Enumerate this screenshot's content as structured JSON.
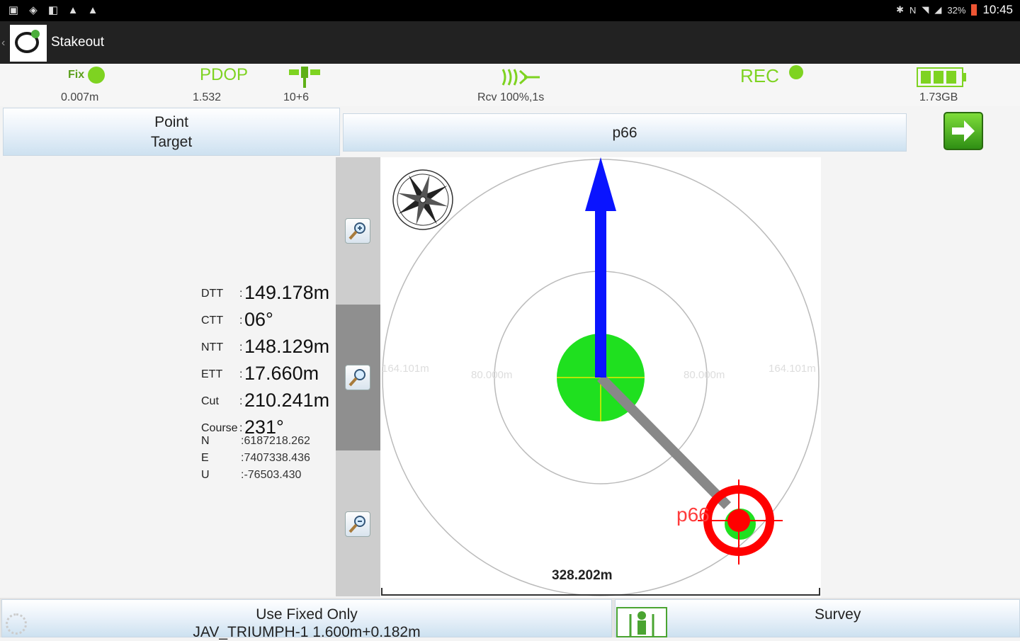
{
  "status_bar": {
    "left_icons": [
      "gallery-icon",
      "shield-icon",
      "mute-icon",
      "warning-icon",
      "warning-icon"
    ],
    "right_icons": [
      "bluetooth-icon",
      "nfc-icon",
      "wifi-icon",
      "signal-icon",
      "battery-icon"
    ],
    "battery_text": "32%",
    "time": "10:45"
  },
  "action_bar": {
    "title": "Stakeout"
  },
  "info_bar": {
    "fix_label": "Fix",
    "fix_value": "0.007m",
    "pdop_label": "PDOP",
    "pdop_value": "1.532",
    "sats_value": "10+6",
    "rcv_value": "Rcv 100%,1s",
    "rec_label": "REC",
    "storage_value": "1.73GB",
    "accent_color": "#7ed321"
  },
  "target": {
    "line1": "Point",
    "line2": "Target",
    "point_name": "p66"
  },
  "readouts": [
    {
      "label": "DTT",
      "value": "149.178m",
      "size": "big"
    },
    {
      "label": "CTT",
      "value": "06°",
      "size": "big"
    },
    {
      "label": "NTT",
      "value": "148.129m",
      "size": "big"
    },
    {
      "label": "ETT",
      "value": "17.660m",
      "size": "big"
    },
    {
      "label": "Cut",
      "value": "210.241m",
      "size": "big"
    },
    {
      "label": "Course",
      "value": "231°",
      "size": "big"
    },
    {
      "label": "N",
      "value": "6187218.262",
      "size": "small"
    },
    {
      "label": "E",
      "value": "7407338.436",
      "size": "small"
    },
    {
      "label": "U",
      "value": "-76503.430",
      "size": "small"
    }
  ],
  "map": {
    "ring_left_outer": "164.101m",
    "ring_left_inner": "80.000m",
    "ring_right_inner": "80.000m",
    "ring_right_outer": "164.101m",
    "scale_text": "328.202m",
    "point_label": "p66",
    "arrow_color": "#0a14ff",
    "target_color": "#ff0000",
    "center_color": "#1fe01f"
  },
  "bottom": {
    "fix_line1": "Use Fixed Only",
    "fix_line2": "JAV_TRIUMPH-1 1.600m+0.182m",
    "survey_label": "Survey"
  }
}
